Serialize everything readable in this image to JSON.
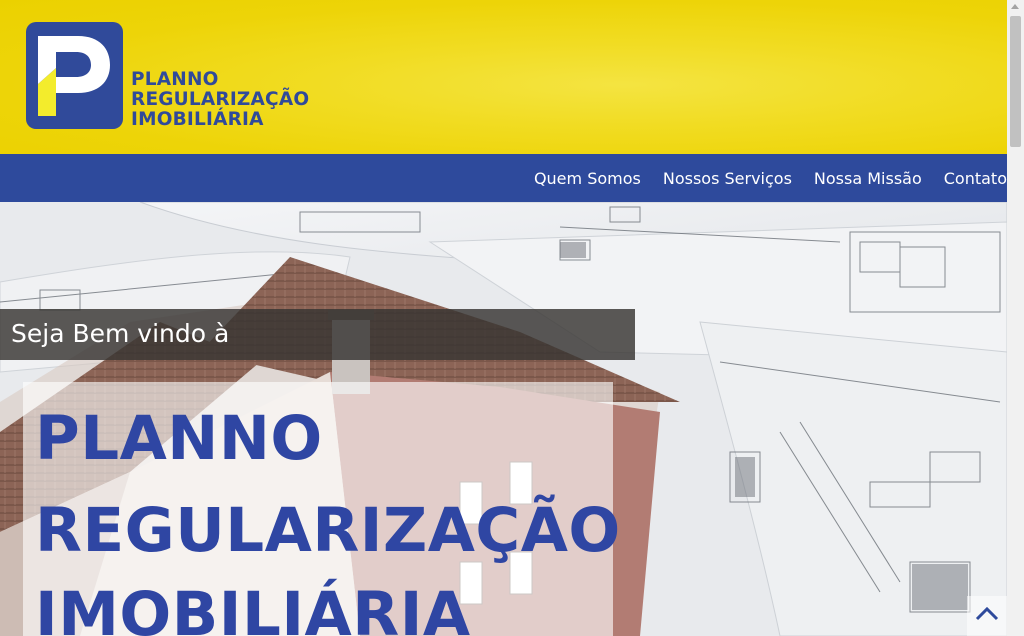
{
  "brand": {
    "logo_letter": "P",
    "name_lines": [
      "PLANNO",
      "REGULARIZAÇÃO",
      "IMOBILIÁRIA"
    ],
    "colors": {
      "primary_blue": "#2e4a9c",
      "yellow": "#edd408",
      "accent_yellow": "#f3ec2c"
    }
  },
  "nav": {
    "items": [
      {
        "label": "Quem Somos"
      },
      {
        "label": "Nossos Serviços"
      },
      {
        "label": "Nossa Missão"
      },
      {
        "label": "Contato"
      }
    ]
  },
  "hero": {
    "welcome": "Seja Bem vindo à",
    "title_lines": [
      "PLANNO",
      "REGULARIZAÇÃO",
      "IMOBILIÁRIA"
    ]
  },
  "icons": {
    "scroll_top": "chevron-up-icon"
  }
}
